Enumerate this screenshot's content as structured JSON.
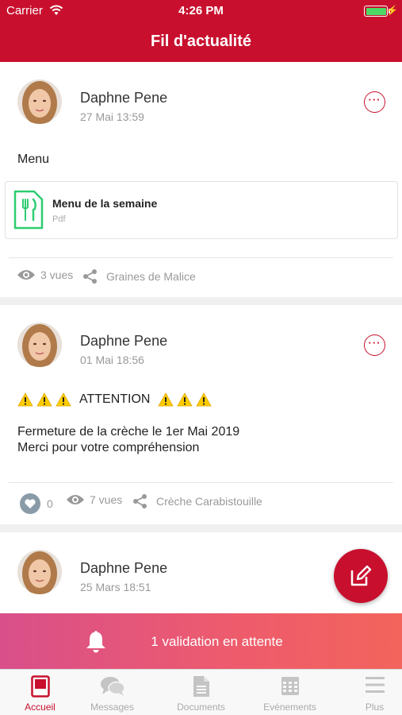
{
  "status_bar": {
    "carrier": "Carrier",
    "time": "4:26 PM"
  },
  "nav": {
    "title": "Fil d'actualité"
  },
  "colors": {
    "brand": "#c8102e",
    "attachment_icon": "#2ecc71",
    "banner_start": "#d94f8a",
    "banner_end": "#f2645c"
  },
  "posts": [
    {
      "author": "Daphne Pene",
      "date": "27 Mai 13:59",
      "more": "···",
      "text": "Menu",
      "attachment": {
        "name": "Menu de la semaine",
        "type": "Pdf",
        "icon": "fork-knife-icon"
      },
      "views": "3 vues",
      "shared_with": "Graines de Malice"
    },
    {
      "author": "Daphne Pene",
      "date": "01 Mai 18:56",
      "more": "···",
      "title": "ATTENTION",
      "line1": "Fermeture de la crèche le 1er Mai 2019",
      "line2": "Merci pour votre compréhension",
      "likes": "0",
      "views": "7 vues",
      "shared_with": "Crèche Carabistouille"
    },
    {
      "author": "Daphne Pene",
      "date": "25 Mars 18:51"
    }
  ],
  "banner": {
    "text": "1 validation en attente"
  },
  "tabs": [
    {
      "label": "Accueil",
      "icon": "home-icon",
      "active": true
    },
    {
      "label": "Messages",
      "icon": "chat-icon"
    },
    {
      "label": "Documents",
      "icon": "document-icon"
    },
    {
      "label": "Evénements",
      "icon": "calendar-icon"
    },
    {
      "label": "Plus",
      "icon": "menu-icon"
    }
  ]
}
